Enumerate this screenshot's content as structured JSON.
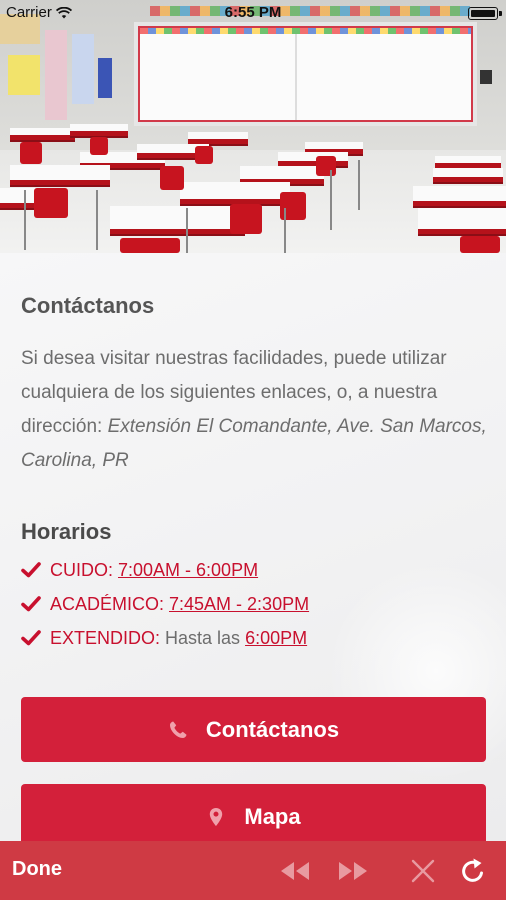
{
  "status_bar": {
    "carrier": "Carrier",
    "time": "6:55 PM"
  },
  "page": {
    "title": "Contáctanos",
    "intro_text": "Si desea visitar nuestras facilidades, puede utilizar cualquiera de los siguientes enlaces, o, a nuestra dirección: ",
    "address": "Extensión El Comandante, Ave. San Marcos, Carolina, PR"
  },
  "hours": {
    "title": "Horarios",
    "items": [
      {
        "label": "CUIDO:",
        "prefix": "",
        "value": "7:00AM - 6:00PM"
      },
      {
        "label": "ACADÉMICO:",
        "prefix": "",
        "value": "7:45AM - 2:30PM"
      },
      {
        "label": "EXTENDIDO:",
        "prefix": "Hasta las",
        "value": "6:00PM"
      }
    ]
  },
  "buttons": {
    "contact_label": "Contáctanos",
    "map_label": "Mapa"
  },
  "toolbar": {
    "done_label": "Done"
  },
  "colors": {
    "accent": "#d3203a",
    "toolbar": "#cf3a44",
    "text": "#6d6d6d"
  },
  "icons": {
    "check": "check-icon",
    "phone": "phone-icon",
    "map_pin": "map-pin-icon",
    "back": "rewind-icon",
    "forward": "fast-forward-icon",
    "stop": "close-icon",
    "reload": "reload-icon"
  }
}
